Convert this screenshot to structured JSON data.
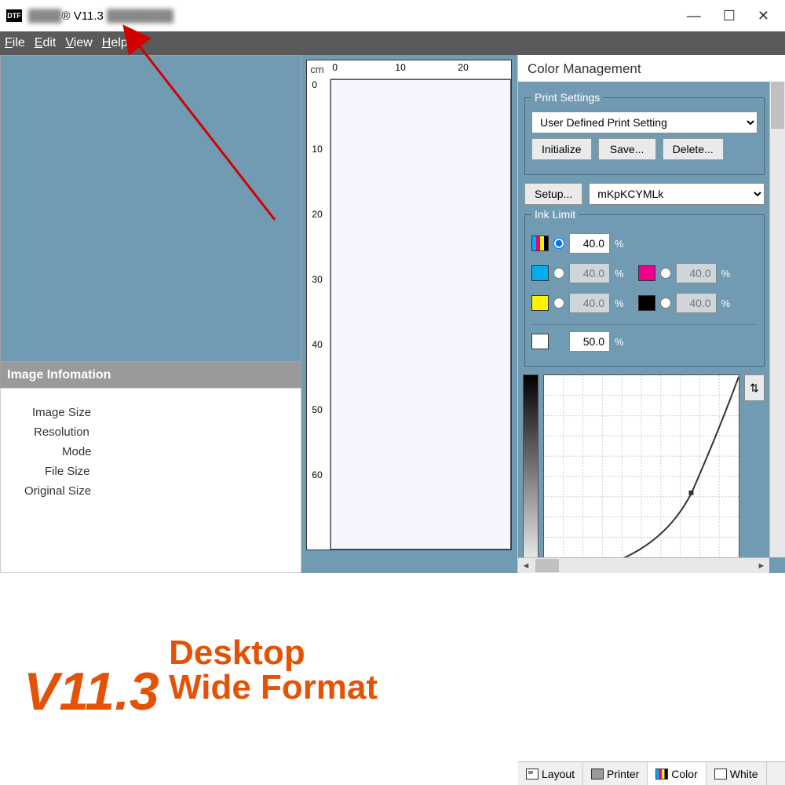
{
  "title": {
    "app_icon": "DTF",
    "registered": "®",
    "version": "V11.3"
  },
  "window_controls": {
    "min": "—",
    "max": "☐",
    "close": "✕"
  },
  "menu": {
    "file": "File",
    "edit": "Edit",
    "view": "View",
    "help": "Help"
  },
  "left": {
    "info_title": "Image Infomation",
    "rows": [
      "Image Size",
      "Resolution",
      "Mode",
      "File Size",
      "Original Size"
    ]
  },
  "ruler": {
    "unit": "cm",
    "top": [
      "0",
      "10",
      "20"
    ],
    "left": [
      "0",
      "10",
      "20",
      "30",
      "40",
      "50",
      "60"
    ]
  },
  "right": {
    "panel_title": "Color Management",
    "print_settings_legend": "Print Settings",
    "print_setting_value": "User Defined Print Setting",
    "btn_init": "Initialize",
    "btn_save": "Save...",
    "btn_delete": "Delete...",
    "btn_setup": "Setup...",
    "ink_mode": "mKpKCYMLk",
    "ink_limit_legend": "Ink Limit",
    "cmyk_value": "40.0",
    "c_value": "40.0",
    "m_value": "40.0",
    "y_value": "40.0",
    "k_value": "40.0",
    "w_value": "50.0",
    "pct": "%"
  },
  "tabs": {
    "layout": "Layout",
    "printer": "Printer",
    "color": "Color",
    "white": "White"
  },
  "watermark": {
    "version": "V11.3",
    "line1": "Desktop",
    "line2": "Wide Format"
  }
}
